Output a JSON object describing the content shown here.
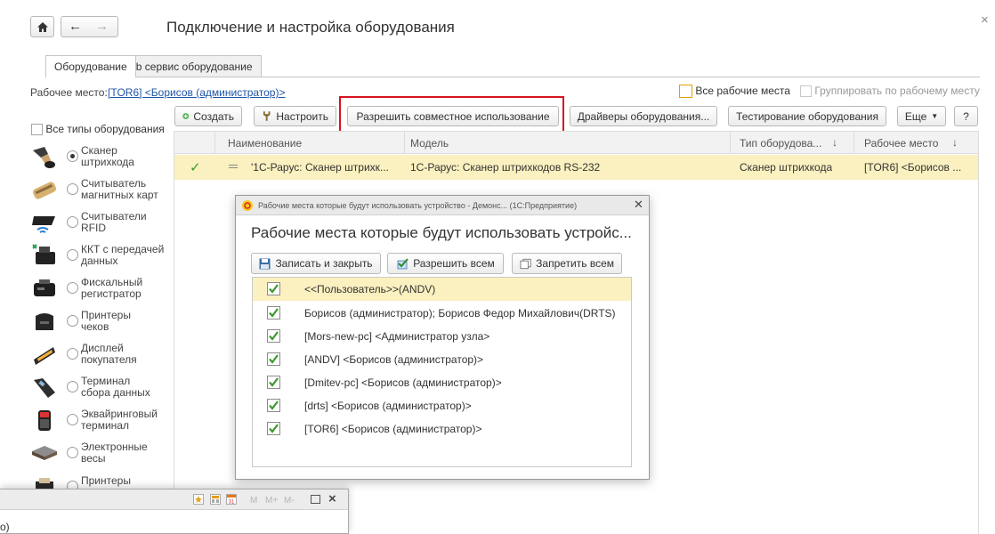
{
  "window": {
    "title": "Подключение и настройка оборудования",
    "close_glyph": "×"
  },
  "nav": {
    "home_glyph": "⌂",
    "back_glyph": "←",
    "forward_glyph": "→"
  },
  "tabs": [
    {
      "label": "Оборудование",
      "active": true
    },
    {
      "label": "Web сервис оборудование",
      "active": false
    }
  ],
  "workplace": {
    "label": "Рабочее место:",
    "link": "[TOR6] <Борисов (администратор)>",
    "all_places_label": "Все рабочие места",
    "group_by_label": "Группировать по рабочему месту"
  },
  "toolbar": {
    "create": "Создать",
    "setup": "Настроить",
    "allow_shared": "Разрешить совместное использование",
    "drivers": "Драйверы оборудования...",
    "testing": "Тестирование оборудования",
    "more": "Еще",
    "help": "?"
  },
  "types": {
    "all_types_label": "Все типы оборудования",
    "items": [
      {
        "label": "Сканер штрихкода",
        "icon": "barcode-scanner-icon",
        "selected": true
      },
      {
        "label": "Считыватель магнитных карт",
        "icon": "magnetic-card-reader-icon",
        "selected": false
      },
      {
        "label": "Считыватели RFID",
        "icon": "rfid-reader-icon",
        "selected": false
      },
      {
        "label": "ККТ с передачей данных",
        "icon": "cash-register-icon",
        "selected": false
      },
      {
        "label": "Фискальный регистратор",
        "icon": "fiscal-printer-icon",
        "selected": false
      },
      {
        "label": "Принтеры чеков",
        "icon": "receipt-printer-icon",
        "selected": false
      },
      {
        "label": "Дисплей покупателя",
        "icon": "customer-display-icon",
        "selected": false
      },
      {
        "label": "Терминал сбора данных",
        "icon": "data-terminal-icon",
        "selected": false
      },
      {
        "label": "Эквайринговый терминал",
        "icon": "payment-terminal-icon",
        "selected": false
      },
      {
        "label": "Электронные весы",
        "icon": "scales-icon",
        "selected": false
      },
      {
        "label": "Принтеры",
        "icon": "label-printer-icon",
        "selected": false
      }
    ]
  },
  "grid": {
    "columns": {
      "name": "Наименование",
      "model": "Модель",
      "type": "Тип оборудова...",
      "workplace": "Рабочее место"
    },
    "sort_glyph": "↓",
    "rows": [
      {
        "check": "✓",
        "name": "'1С-Рарус: Сканер штрихк...",
        "model": "1С-Рарус: Сканер штрихкодов RS-232",
        "type": "Сканер штрихкода",
        "workplace": "[TOR6] <Борисов ..."
      }
    ]
  },
  "dialog": {
    "window_title": "Рабочие места которые будут использовать устройство - Демонс... (1С:Предприятие)",
    "heading": "Рабочие места которые будут использовать устройс...",
    "write_close": "Записать и закрыть",
    "allow_all": "Разрешить всем",
    "deny_all": "Запретить всем",
    "rows": [
      {
        "label": "<<Пользователь>>(ANDV)",
        "checked": true
      },
      {
        "label": "Борисов (администратор); Борисов Федор Михайлович(DRTS)",
        "checked": true
      },
      {
        "label": "[Mors-new-pc] <Администратор узла>",
        "checked": true
      },
      {
        "label": "[ANDV] <Борисов (администратор)>",
        "checked": true
      },
      {
        "label": "[Dmitev-pc] <Борисов (администратор)>",
        "checked": true
      },
      {
        "label": "[drts] <Борисов (администратор)>",
        "checked": true
      },
      {
        "label": "[TOR6] <Борисов (администратор)>",
        "checked": true
      }
    ]
  },
  "bottom_window": {
    "title_fragment": "о)",
    "buttons": [
      "M",
      "M+",
      "M-"
    ],
    "close_glyph": "×"
  },
  "colors": {
    "highlight_red": "#d9141e",
    "selected_row": "#fbf0bf",
    "check_green": "#3c9a2c",
    "link_blue": "#1f55a8"
  }
}
